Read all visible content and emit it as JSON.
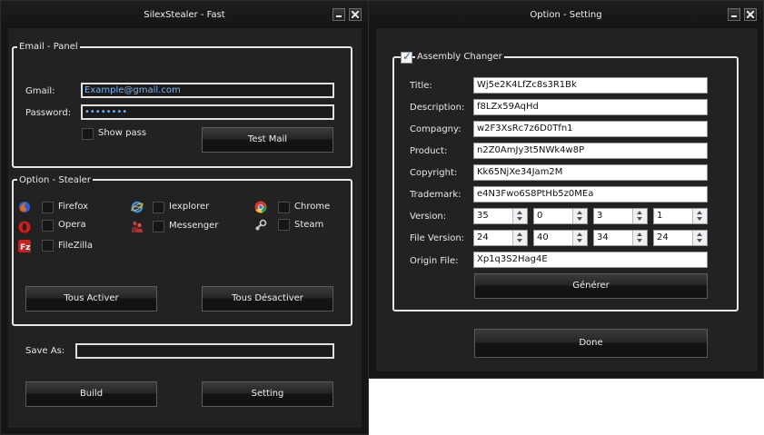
{
  "main_window": {
    "title": "SilexStealer - Fast",
    "email_panel": {
      "legend": "Email - Panel",
      "gmail_label": "Gmail:",
      "gmail_value": "Example@gmail.com",
      "password_label": "Password:",
      "password_value": "••••••••",
      "show_pass_label": "Show pass",
      "test_mail_button": "Test Mail"
    },
    "option_stealer": {
      "legend": "Option - Stealer",
      "items": [
        {
          "label": "Firefox",
          "icon": "firefox-icon"
        },
        {
          "label": "Iexplorer",
          "icon": "internet-explorer-icon"
        },
        {
          "label": "Chrome",
          "icon": "chrome-icon"
        },
        {
          "label": "Opera",
          "icon": "opera-icon"
        },
        {
          "label": "Messenger",
          "icon": "messenger-icon"
        },
        {
          "label": "Steam",
          "icon": "steam-icon"
        },
        {
          "label": "FileZilla",
          "icon": "filezilla-icon"
        }
      ],
      "activate_all_button": "Tous Activer",
      "deactivate_all_button": "Tous Désactiver"
    },
    "save_as_label": "Save As:",
    "save_as_value": "",
    "build_button": "Build",
    "setting_button": "Setting"
  },
  "option_window": {
    "title": "Option - Setting",
    "assembly_changer": {
      "legend": "Assembly Changer",
      "checked": true,
      "title_label": "Title:",
      "title_value": "Wj5e2K4LfZc8s3R1Bk",
      "description_label": "Description:",
      "description_value": "f8LZx59AqHd",
      "company_label": "Compagny:",
      "company_value": "w2F3XsRc7z6D0Tfn1",
      "product_label": "Product:",
      "product_value": "n2Z0AmJy3t5NWk4w8P",
      "copyright_label": "Copyright:",
      "copyright_value": "Kk65NjXe34Jam2M",
      "trademark_label": "Trademark:",
      "trademark_value": "e4N3Fwo6S8PtHb5z0MEa",
      "version_label": "Version:",
      "version": [
        "35",
        "0",
        "3",
        "1"
      ],
      "file_version_label": "File Version:",
      "file_version": [
        "24",
        "40",
        "34",
        "24"
      ],
      "origin_file_label": "Origin File:",
      "origin_file_value": "Xp1q3S2Hag4E",
      "generate_button": "Générer"
    },
    "done_button": "Done"
  },
  "colors": {
    "window_bg": "#222222",
    "titlebar_bg": "#161616",
    "field_text": "#6fb6ff",
    "group_border": "#e6e6e6"
  }
}
